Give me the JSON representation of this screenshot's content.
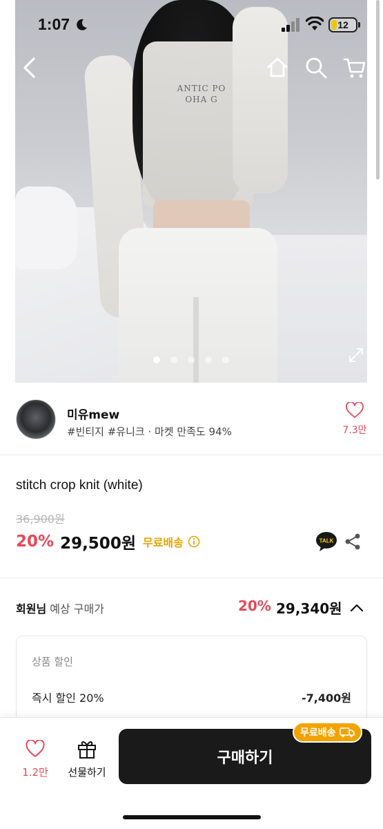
{
  "status_bar": {
    "time": "1:07",
    "battery": "12",
    "icons": [
      "moon-icon",
      "signal-icon",
      "wifi-icon",
      "battery-icon"
    ]
  },
  "nav": {
    "icons": [
      "back-icon",
      "home-icon",
      "search-icon",
      "cart-icon"
    ]
  },
  "gallery": {
    "print_lines": [
      "ANTIC PO",
      "OHA G"
    ],
    "dot_count": 5,
    "active_index": 0
  },
  "seller": {
    "name": "미유mew",
    "tags": "#빈티지 #유니크 · 마켓 만족도 94%",
    "likes": "7.3만"
  },
  "product": {
    "title": "stitch crop knit (white)",
    "original_price": "36,900원",
    "discount": "20%",
    "price": "29,500원",
    "free_shipping": "무료배송"
  },
  "member": {
    "label_bold": "회원님",
    "label_rest": " 예상 구매가",
    "discount": "20%",
    "price": "29,340원"
  },
  "breakdown": {
    "title": "상품 할인",
    "row_label": "즉시 할인 20%",
    "row_value": "-7,400원"
  },
  "bottom_bar": {
    "like_count": "1.2만",
    "gift_label": "선물하기",
    "buy_label": "구매하기",
    "shipping_badge": "무료배송"
  },
  "colors": {
    "accent_red": "#e8475a",
    "shipping_yellow": "#e6a400",
    "badge_orange": "#f3a300",
    "buy_button": "#1a1a1a"
  }
}
